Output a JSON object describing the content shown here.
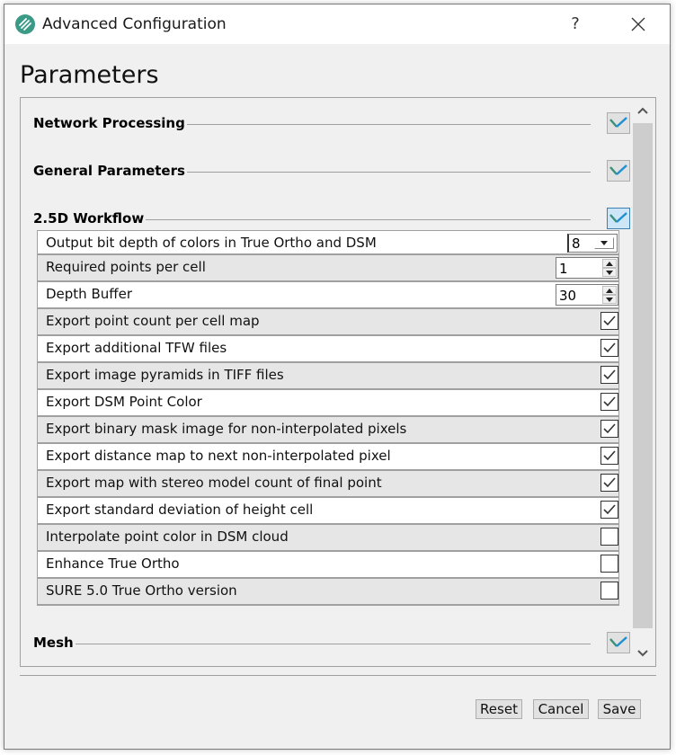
{
  "window": {
    "title": "Advanced Configuration",
    "help_label": "?",
    "icons": {
      "app": "app-logo-icon",
      "close": "close-icon"
    }
  },
  "page_title": "Parameters",
  "sections": [
    {
      "title": "Network Processing",
      "expanded": false
    },
    {
      "title": "General Parameters",
      "expanded": false
    },
    {
      "title": "2.5D Workflow",
      "expanded": true
    },
    {
      "title": "Mesh",
      "expanded": false
    }
  ],
  "workflow_rows": [
    {
      "label": "Output bit depth of colors in True Ortho and DSM",
      "control": "combo",
      "value": "8"
    },
    {
      "label": "Required points per cell",
      "control": "spin",
      "value": "1"
    },
    {
      "label": "Depth Buffer",
      "control": "spin",
      "value": "30"
    },
    {
      "label": "Export point count per cell map",
      "control": "checkbox",
      "checked": true
    },
    {
      "label": "Export additional TFW files",
      "control": "checkbox",
      "checked": true
    },
    {
      "label": "Export image pyramids in TIFF files",
      "control": "checkbox",
      "checked": true
    },
    {
      "label": "Export DSM Point Color",
      "control": "checkbox",
      "checked": true
    },
    {
      "label": "Export binary mask image for non-interpolated pixels",
      "control": "checkbox",
      "checked": true
    },
    {
      "label": "Export distance map to next non-interpolated pixel",
      "control": "checkbox",
      "checked": true
    },
    {
      "label": "Export map with stereo model count of final point",
      "control": "checkbox",
      "checked": true
    },
    {
      "label": "Export standard deviation of height cell",
      "control": "checkbox",
      "checked": true
    },
    {
      "label": "Interpolate point color in DSM cloud",
      "control": "checkbox",
      "checked": false
    },
    {
      "label": "Enhance True Ortho",
      "control": "checkbox",
      "checked": false
    },
    {
      "label": "SURE 5.0 True Ortho version",
      "control": "checkbox",
      "checked": false
    }
  ],
  "buttons": {
    "reset": "Reset",
    "cancel": "Cancel",
    "save": "Save"
  },
  "colors": {
    "accent_teal": "#3a8f7a",
    "accent_blue": "#1e8fd0"
  }
}
